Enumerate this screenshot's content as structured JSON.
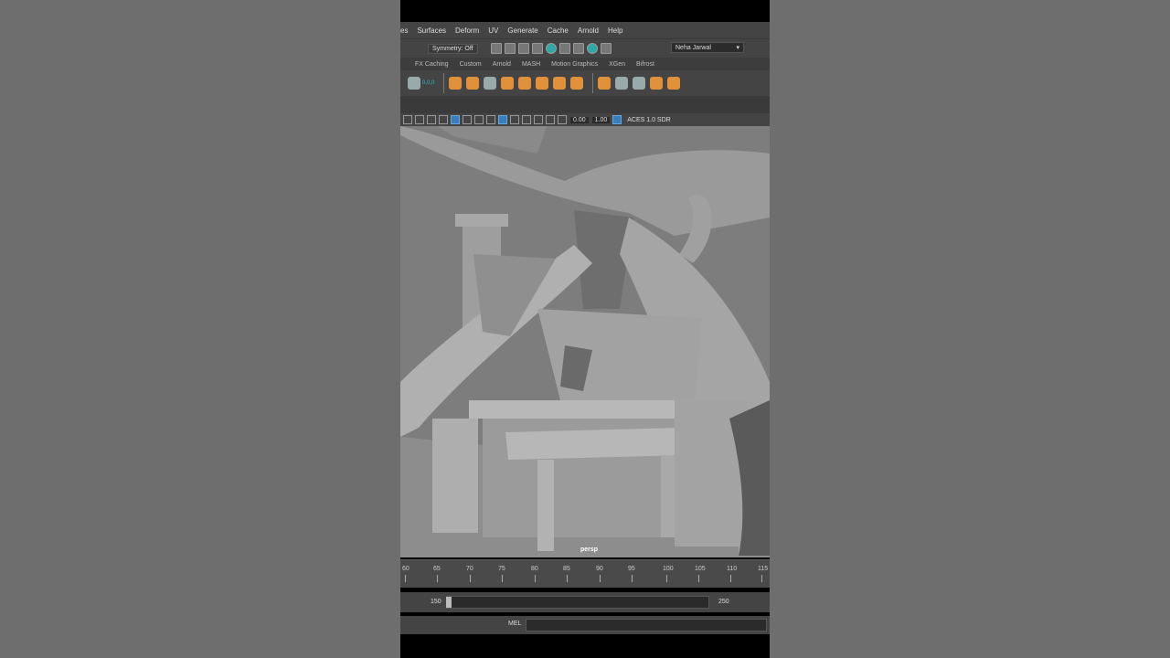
{
  "menu": [
    "es",
    "Surfaces",
    "Deform",
    "UV",
    "Generate",
    "Cache",
    "Arnold",
    "Help"
  ],
  "status": {
    "symmetry": "Symmetry: Off",
    "user": "Neha Jarwal"
  },
  "shelf_tabs": [
    "FX Caching",
    "Custom",
    "Arnold",
    "MASH",
    "Motion Graphics",
    "XGen",
    "Bifrost"
  ],
  "shelf": {
    "coords": "0,0,0"
  },
  "panel": {
    "exposure": "0.00",
    "gamma": "1.00",
    "colorspace": "ACES 1.0 SDR"
  },
  "viewport": {
    "camera": "persp"
  },
  "timeline": {
    "ticks": [
      "60",
      "65",
      "70",
      "75",
      "80",
      "85",
      "90",
      "95",
      "100",
      "105",
      "110",
      "115"
    ]
  },
  "range": {
    "current": "150",
    "end": "250"
  },
  "command": {
    "mel_label": "MEL"
  }
}
